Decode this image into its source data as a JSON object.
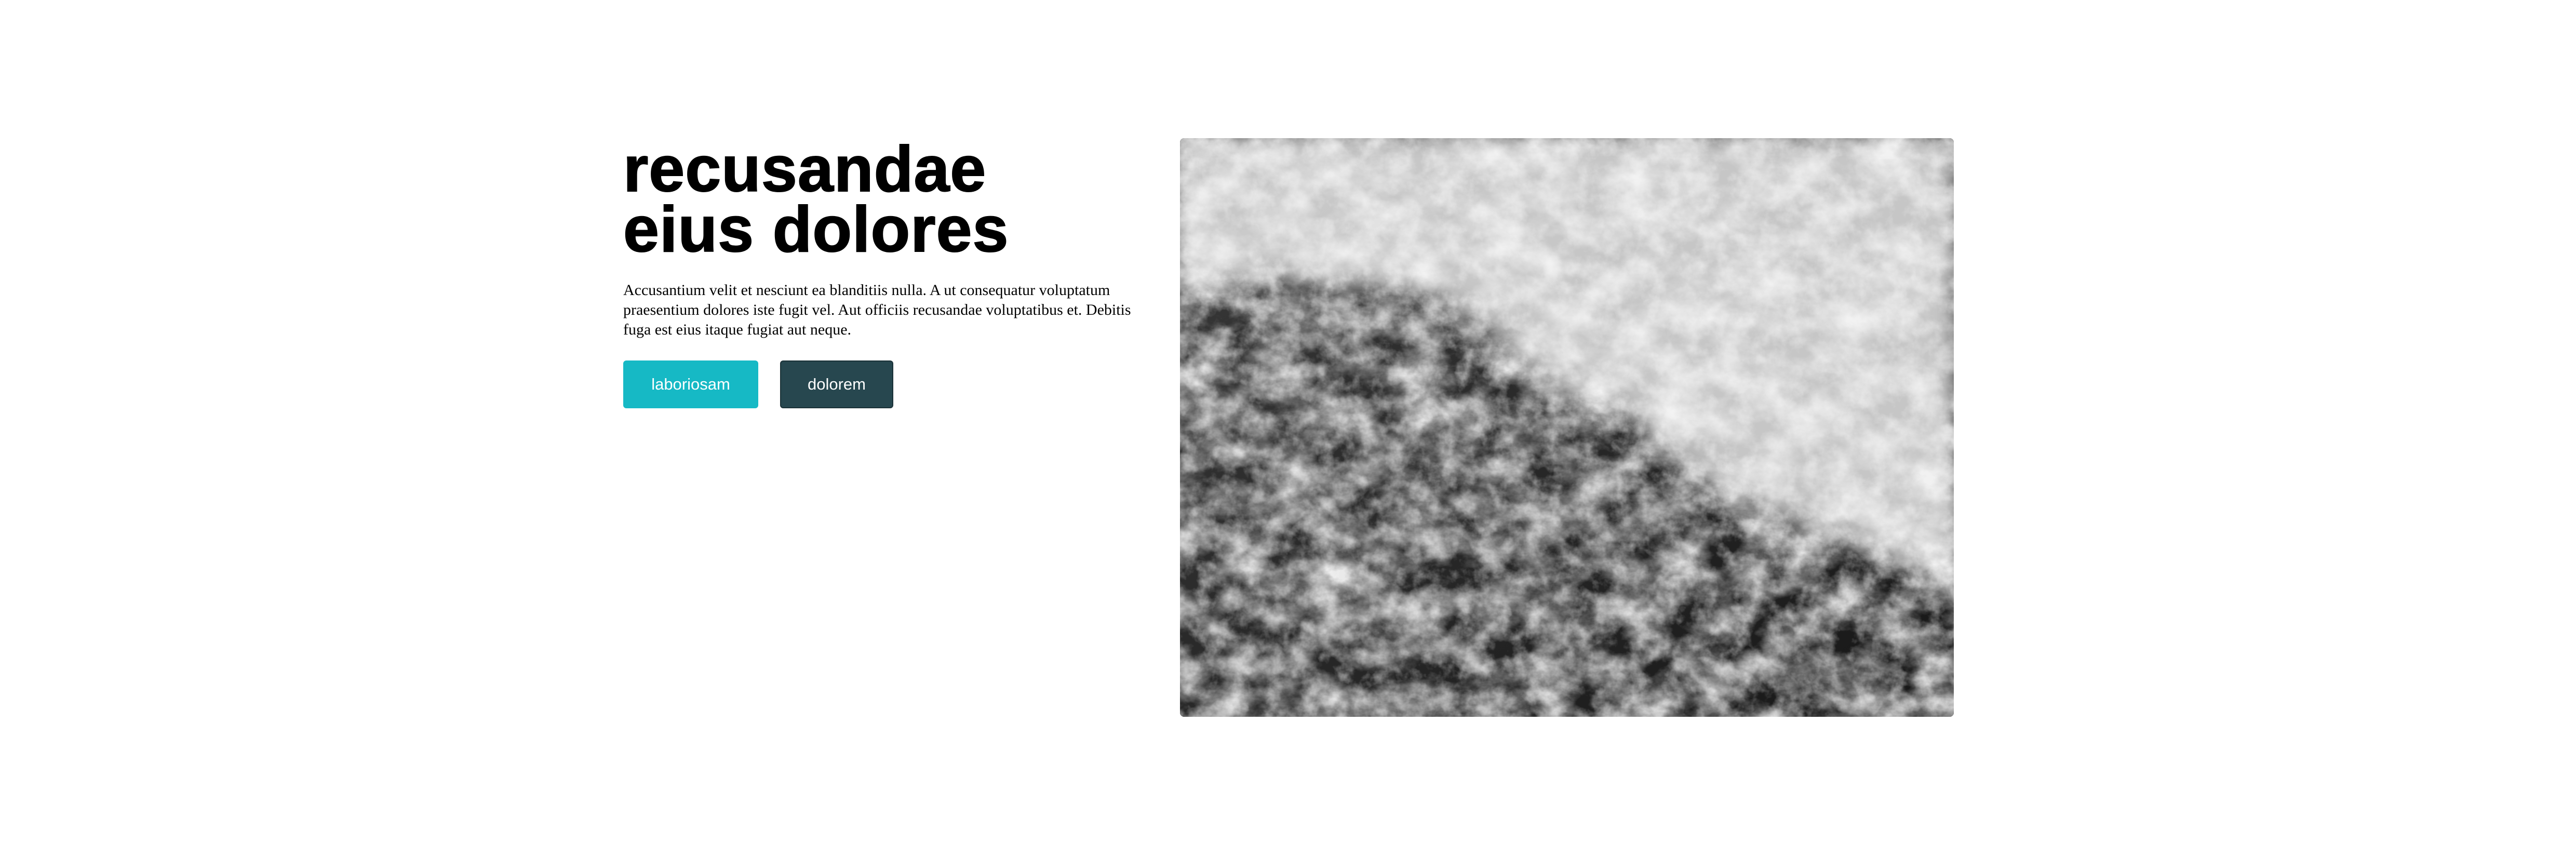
{
  "hero": {
    "headline_line1": "recusandae",
    "headline_line2": "eius dolores",
    "description": "Accusantium velit et nesciunt ea blanditiis nulla. A ut consequatur voluptatum praesentium dolores iste fugit vel. Aut officiis recusandae voluptatibus et. Debitis fuga est eius itaque fugiat aut neque.",
    "primary_button_label": "laboriosam",
    "secondary_button_label": "dolorem",
    "image_subject": "aerial view of ocean wave foam (black and white)"
  },
  "colors": {
    "primary_button": "#16b9c5",
    "secondary_button": "#27474f",
    "text": "#000000",
    "background": "#ffffff"
  }
}
